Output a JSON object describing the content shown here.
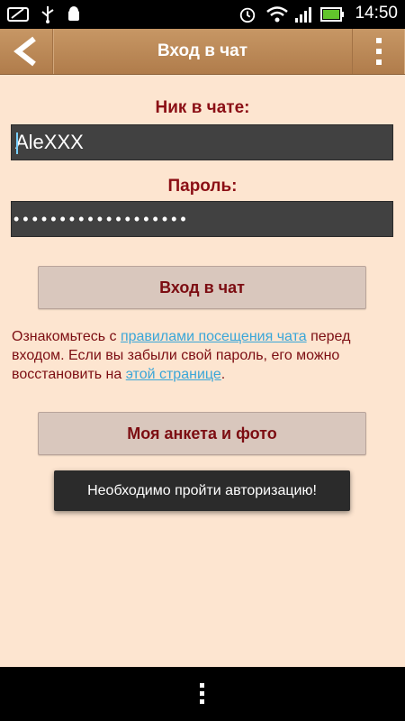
{
  "status_bar": {
    "time": "14:50",
    "icons": [
      "scribble-icon",
      "usb-icon",
      "android-debug-icon",
      "alarm-icon",
      "wifi-icon",
      "signal-icon",
      "battery-icon"
    ]
  },
  "action_bar": {
    "title": "Вход в чат",
    "back_icon": "back-arrow-icon",
    "menu_icon": "overflow-menu-icon",
    "color": "#b98654"
  },
  "form": {
    "nick_label": "Ник в чате:",
    "nick_value": "AleXXX",
    "password_label": "Пароль:",
    "password_value": "•••••••••••••••••••",
    "login_button": "Вход в чат"
  },
  "info": {
    "part1": "Ознакомьтесь с ",
    "rules_link": "правилами посещения чата",
    "part2": " перед входом. Если вы забыли свой пароль, его можно восстановить на ",
    "page_link": "этой странице",
    "part3": "."
  },
  "profile_button": "Моя анкета и фото",
  "toast": "Необходимо пройти авторизацию!",
  "colors": {
    "background": "#fde5d0",
    "accent_text": "#8b0f15",
    "link": "#3aa6d8"
  }
}
